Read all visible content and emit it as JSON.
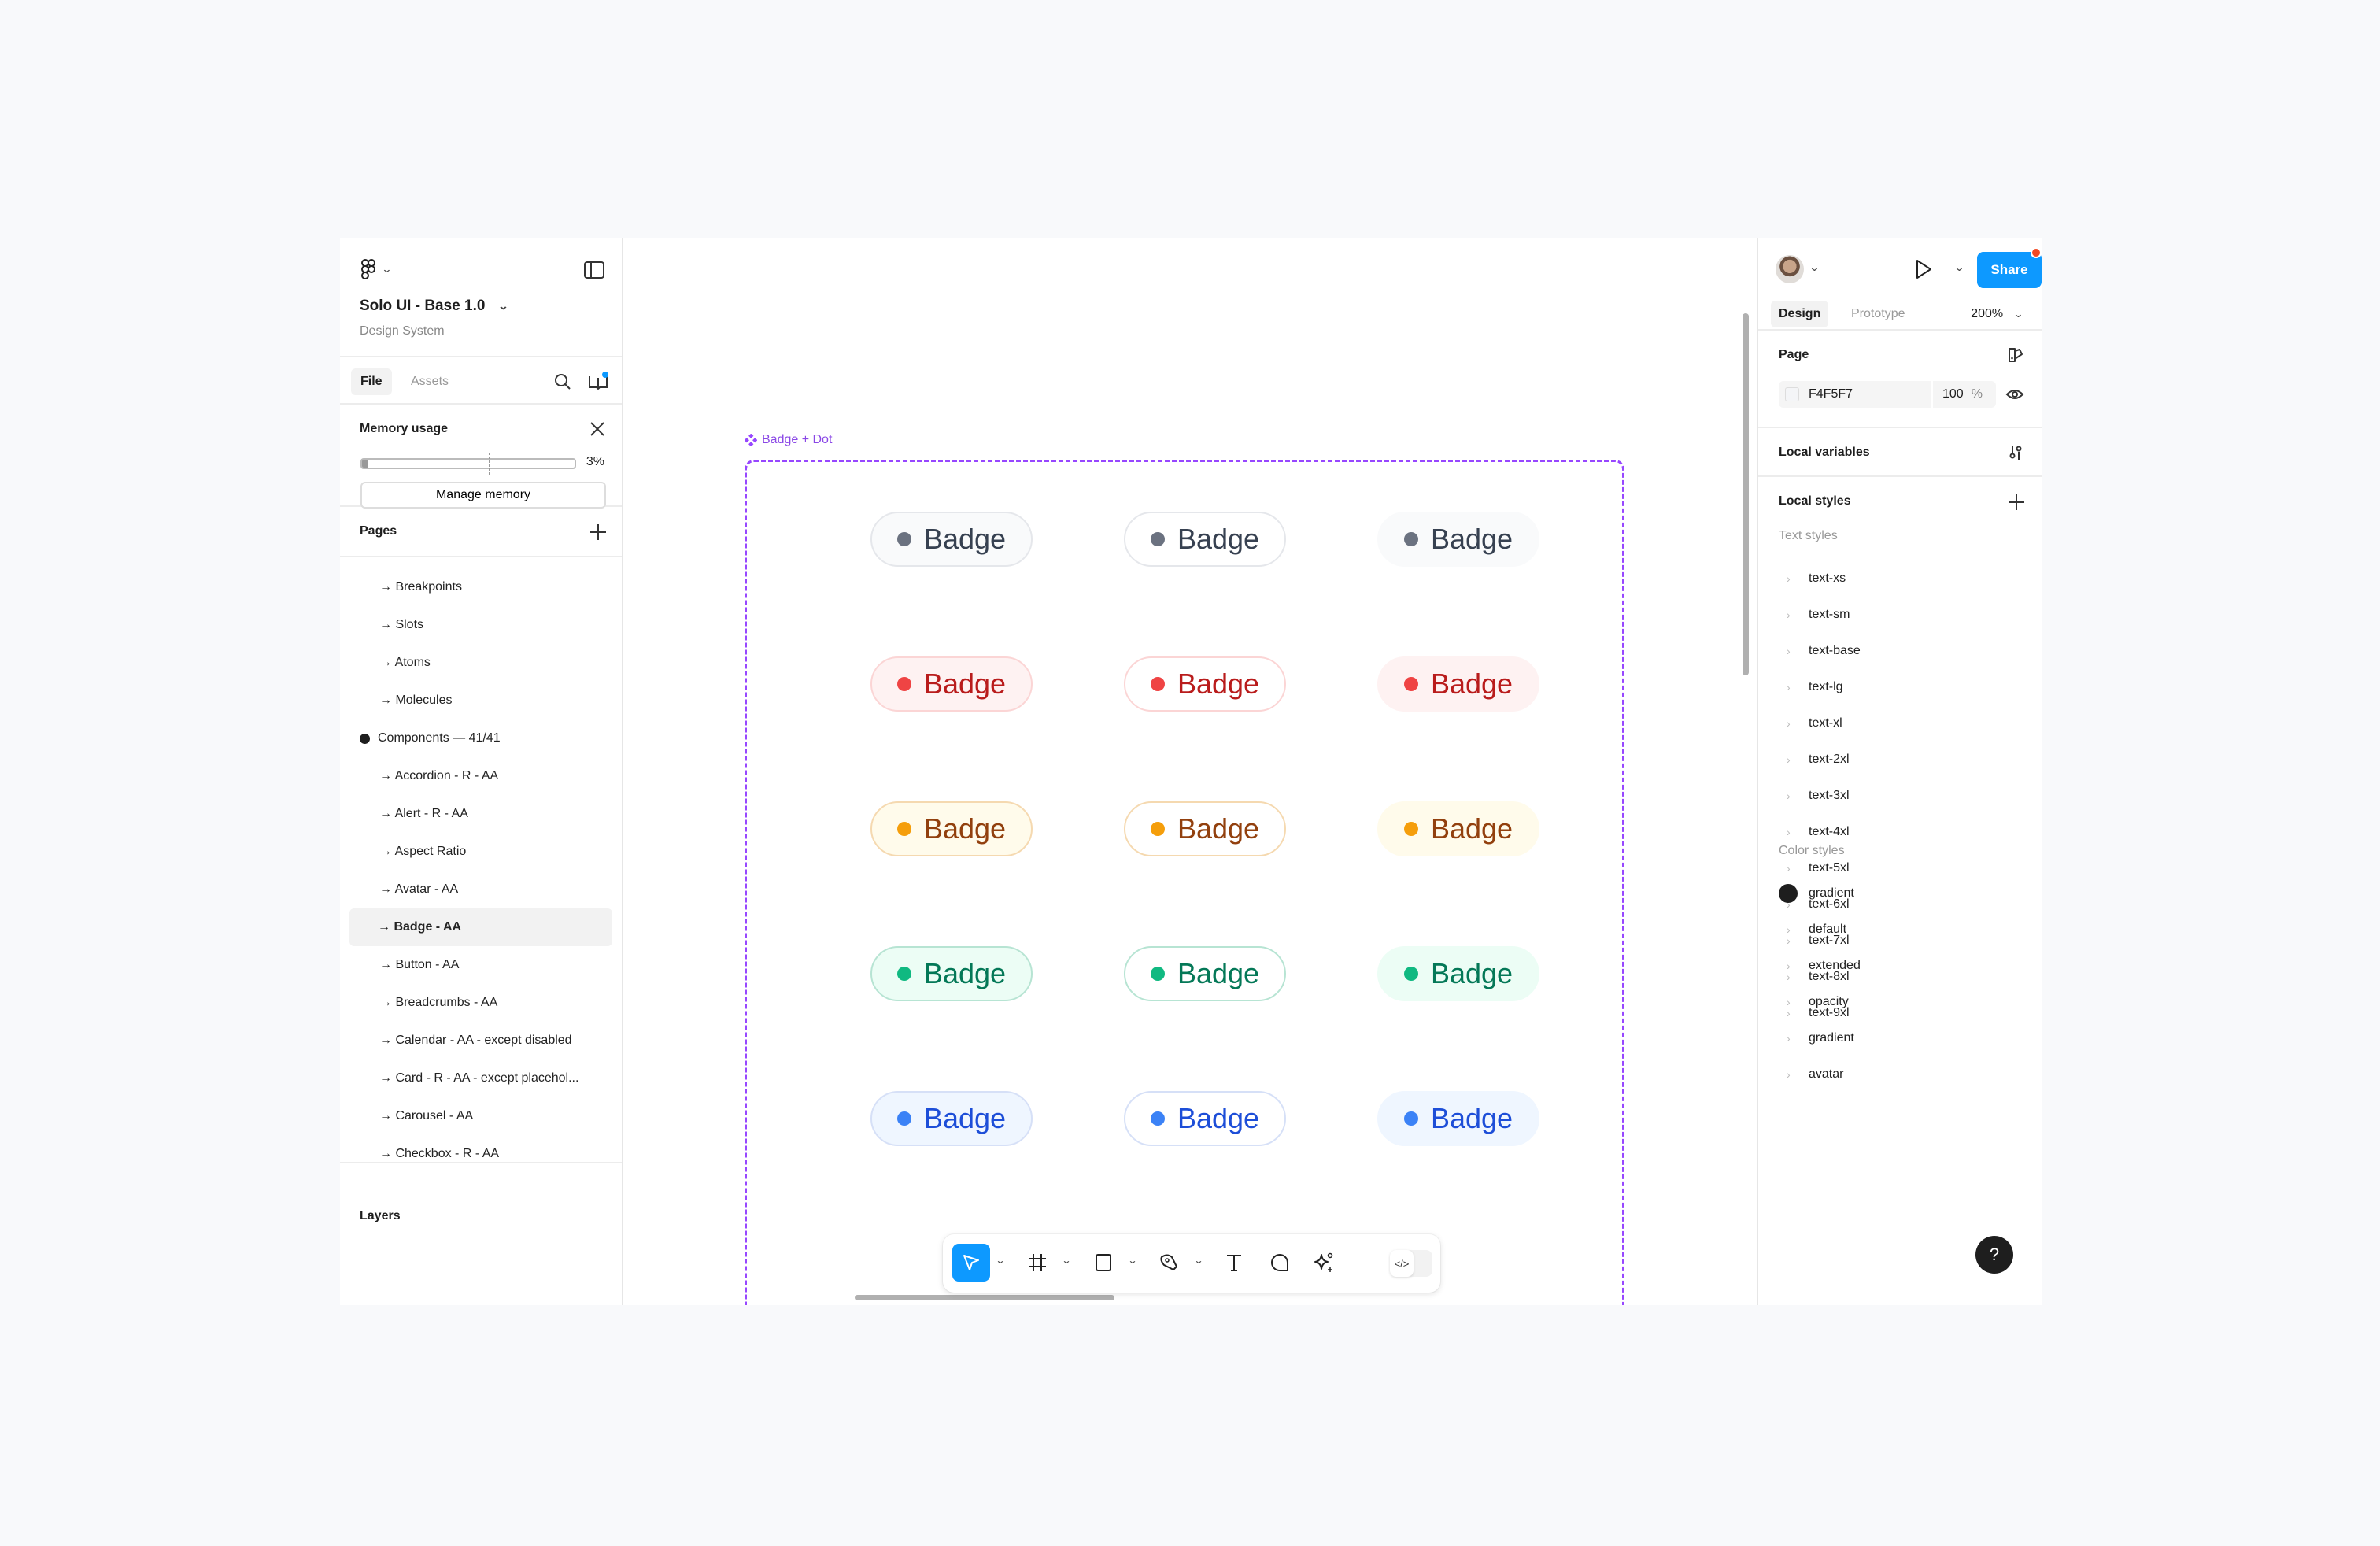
{
  "file": {
    "title": "Solo UI - Base 1.0",
    "subtitle": "Design System"
  },
  "left_tabs": {
    "file": "File",
    "assets": "Assets"
  },
  "memory": {
    "title": "Memory usage",
    "percent": 3,
    "percent_label": "3%",
    "button": "Manage memory"
  },
  "pages": {
    "title": "Pages",
    "items": [
      {
        "label": "→ Breakpoints"
      },
      {
        "label": "→ Slots"
      },
      {
        "label": "→ Atoms"
      },
      {
        "label": "→ Molecules"
      },
      {
        "label": "Components — 41/41",
        "current_section": true
      },
      {
        "label": "→ Accordion - R - AA"
      },
      {
        "label": "→ Alert - R - AA"
      },
      {
        "label": "→ Aspect Ratio"
      },
      {
        "label": "→ Avatar - AA"
      },
      {
        "label": "→ Badge - AA",
        "selected": true
      },
      {
        "label": "→ Button - AA"
      },
      {
        "label": "→ Breadcrumbs  - AA"
      },
      {
        "label": "→ Calendar - AA - except disabled"
      },
      {
        "label": "→ Card - R - AA - except placehol..."
      },
      {
        "label": "→ Carousel  - AA"
      },
      {
        "label": "→ Checkbox - R - AA"
      }
    ]
  },
  "layers": {
    "title": "Layers"
  },
  "canvas": {
    "frame_label": "Badge + Dot",
    "frame_color": "#9747FF",
    "badge_text": "Badge",
    "variants": [
      "outline-filled",
      "outline",
      "soft"
    ],
    "rows": [
      {
        "name": "gray",
        "dot": "#6B7280",
        "text": "#374151",
        "bg": "#F9FAFB",
        "border": "#E5E7EB"
      },
      {
        "name": "red",
        "dot": "#EF4444",
        "text": "#B91C1C",
        "bg": "#FEF2F2",
        "border": "#FBD5D5"
      },
      {
        "name": "yellow",
        "dot": "#F59E0B",
        "text": "#92400E",
        "bg": "#FFFBEB",
        "border": "#F5D9B0"
      },
      {
        "name": "green",
        "dot": "#10B981",
        "text": "#047857",
        "bg": "#ECFDF5",
        "border": "#B7E4D3"
      },
      {
        "name": "blue",
        "dot": "#3B82F6",
        "text": "#1D4ED8",
        "bg": "#EFF6FF",
        "border": "#D6E0F7"
      }
    ]
  },
  "toolbar": {
    "tools": [
      {
        "name": "move",
        "icon": "cursor-arrow-icon",
        "active": true,
        "has_menu": true
      },
      {
        "name": "frame",
        "icon": "frame-hash-icon",
        "has_menu": true
      },
      {
        "name": "shape",
        "icon": "rectangle-icon",
        "has_menu": true
      },
      {
        "name": "pen",
        "icon": "pen-nib-icon",
        "has_menu": true
      },
      {
        "name": "text",
        "icon": "text-t-icon"
      },
      {
        "name": "comment",
        "icon": "comment-bubble-icon"
      },
      {
        "name": "actions",
        "icon": "sparkle-ai-icon"
      }
    ],
    "dev_mode_icon": "code-brackets-icon",
    "dev_mode_label": "</>",
    "accent": "#0D99FF"
  },
  "right_panel": {
    "share": "Share",
    "tabs": {
      "design": "Design",
      "prototype": "Prototype"
    },
    "zoom": "200%",
    "page": {
      "title": "Page",
      "color_hex": "F4F5F7",
      "opacity": "100",
      "opacity_unit": "%"
    },
    "local_variables": "Local variables",
    "local_styles": "Local styles",
    "text_styles_title": "Text styles",
    "text_styles": [
      "text-xs",
      "text-sm",
      "text-base",
      "text-lg",
      "text-xl",
      "text-2xl",
      "text-3xl",
      "text-4xl",
      "text-5xl",
      "text-6xl",
      "text-7xl",
      "text-8xl",
      "text-9xl"
    ],
    "color_styles_title": "Color styles",
    "color_styles": [
      {
        "name": "gradient",
        "swatch": "#1E1E1E"
      },
      {
        "name": "default",
        "group": true
      },
      {
        "name": "extended",
        "group": true
      },
      {
        "name": "opacity",
        "group": true
      },
      {
        "name": "gradient",
        "group": true
      },
      {
        "name": "avatar",
        "group": true
      }
    ],
    "help": "?"
  }
}
